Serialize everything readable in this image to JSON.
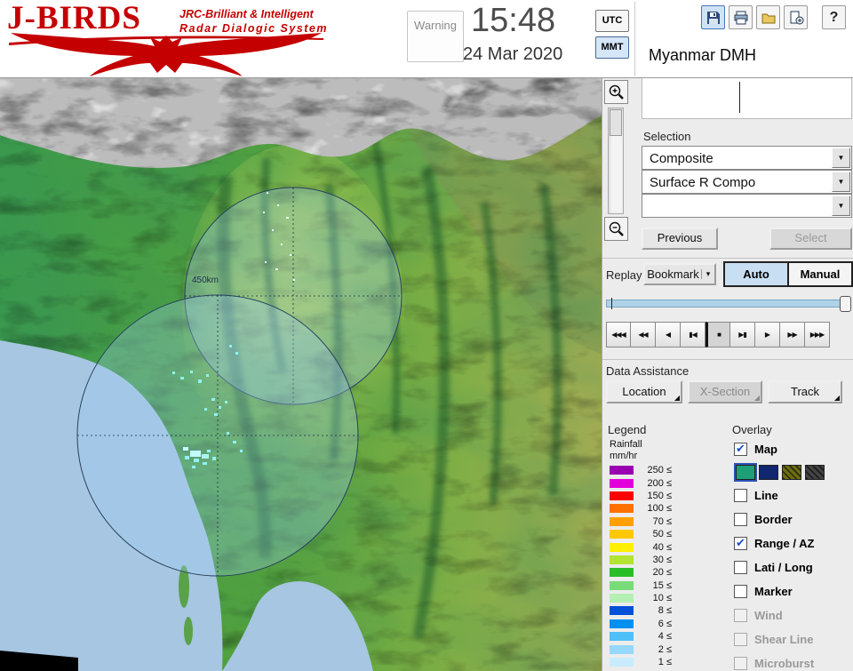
{
  "header": {
    "logo": {
      "title": "J-BIRDS",
      "tagline1": "JRC-Brilliant & Intelligent",
      "tagline2": "Radar  Dialogic  System"
    },
    "warning_label": "Warning",
    "clock": {
      "time": "15:48",
      "date": "24 Mar 2020"
    },
    "timezone": {
      "utc": "UTC",
      "mmt": "MMT"
    },
    "org": "Myanmar DMH",
    "toolbar": {
      "help": "?"
    }
  },
  "map": {
    "range_label": "450km"
  },
  "panel": {
    "selection": {
      "label": "Selection",
      "dropdowns": [
        "Composite",
        "Surface R Compo",
        ""
      ],
      "previous": "Previous",
      "select": "Select"
    },
    "replay": {
      "label": "Replay",
      "bookmark": "Bookmark",
      "bookmark_arrow": "▾",
      "auto": "Auto",
      "manual": "Manual",
      "playback": [
        "◀◀◀",
        "◀◀",
        "◀",
        "▮◀",
        "■",
        "▶▮",
        "▶",
        "▶▶",
        "▶▶▶"
      ]
    },
    "data_assistance": {
      "label": "Data Assistance",
      "buttons": [
        {
          "label": "Location",
          "disabled": false
        },
        {
          "label": "X-Section",
          "disabled": true
        },
        {
          "label": "Track",
          "disabled": false
        }
      ]
    },
    "legend": {
      "label": "Legend",
      "quantity": "Rainfall",
      "unit": "mm/hr",
      "scale": [
        {
          "label": "250 ≤",
          "color": "#9800B0"
        },
        {
          "label": "200 ≤",
          "color": "#E400DC"
        },
        {
          "label": "150 ≤",
          "color": "#FF0000"
        },
        {
          "label": "100 ≤",
          "color": "#FF7000"
        },
        {
          "label": "70 ≤",
          "color": "#FFA000"
        },
        {
          "label": "50 ≤",
          "color": "#FFC800"
        },
        {
          "label": "40 ≤",
          "color": "#FFF000"
        },
        {
          "label": "30 ≤",
          "color": "#B4E432"
        },
        {
          "label": "20 ≤",
          "color": "#28BE28"
        },
        {
          "label": "15 ≤",
          "color": "#78DC78"
        },
        {
          "label": "10 ≤",
          "color": "#B4F0B4"
        },
        {
          "label": "8 ≤",
          "color": "#0050D8"
        },
        {
          "label": "6 ≤",
          "color": "#0090F0"
        },
        {
          "label": "4 ≤",
          "color": "#50C0F8"
        },
        {
          "label": "2 ≤",
          "color": "#96D8FC"
        },
        {
          "label": "1 ≤",
          "color": "#C8ECFE"
        }
      ]
    },
    "overlay": {
      "label": "Overlay",
      "map_styles": [
        {
          "color": "#1f9e78"
        },
        {
          "color": "#10266e"
        },
        {
          "color": "#6e6e14"
        },
        {
          "color": "#444444"
        }
      ],
      "items": [
        {
          "label": "Map",
          "checked": true,
          "disabled": false
        },
        {
          "label": "Line",
          "checked": false,
          "disabled": false
        },
        {
          "label": "Border",
          "checked": false,
          "disabled": false
        },
        {
          "label": "Range / AZ",
          "checked": true,
          "disabled": false
        },
        {
          "label": "Lati / Long",
          "checked": false,
          "disabled": false
        },
        {
          "label": "Marker",
          "checked": false,
          "disabled": false
        },
        {
          "label": "Wind",
          "checked": false,
          "disabled": true
        },
        {
          "label": "Shear Line",
          "checked": false,
          "disabled": true
        },
        {
          "label": "Microburst",
          "checked": false,
          "disabled": true
        }
      ]
    }
  }
}
